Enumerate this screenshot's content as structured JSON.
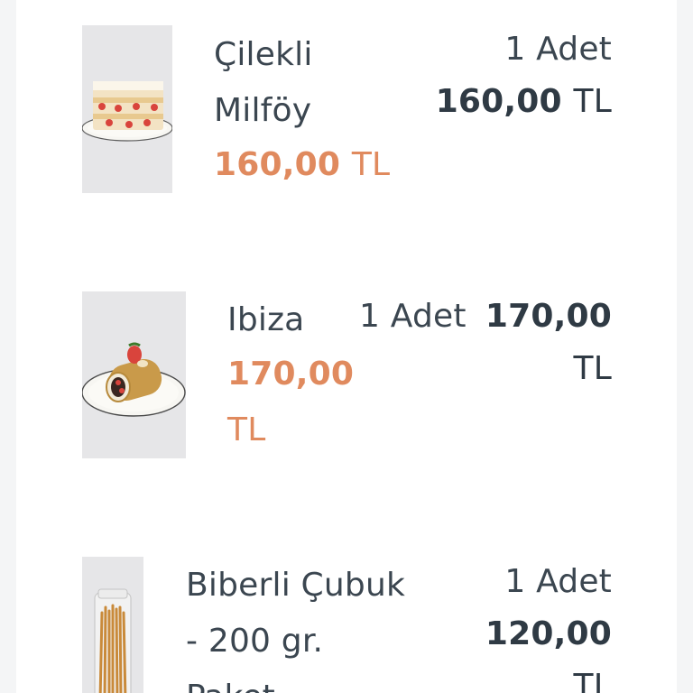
{
  "cart": {
    "items": [
      {
        "name_line1": "Çilekli",
        "name_line2": "Milföy",
        "unit_price": "160,00",
        "currency": "TL",
        "quantity": "1 Adet",
        "total_price": "160,00",
        "total_currency": "TL",
        "thumbnail_icon": "strawberry-millefeuille-photo"
      },
      {
        "name_line1": "Ibiza",
        "unit_price": "170,00",
        "currency": "TL",
        "quantity": "1 Adet",
        "total_price": "170,00",
        "total_currency": "TL",
        "thumbnail_icon": "roll-cake-photo"
      },
      {
        "name_line1": "Biberli Çubuk",
        "name_line2": "- 200 gr.",
        "name_line3": "Paket",
        "quantity": "1 Adet",
        "total_price": "120,00",
        "total_currency": "TL",
        "thumbnail_icon": "breadsticks-jar-photo"
      }
    ]
  },
  "colors": {
    "accent_price": "#e08a5e",
    "text": "#3b4650",
    "background": "#f4f5f6"
  }
}
